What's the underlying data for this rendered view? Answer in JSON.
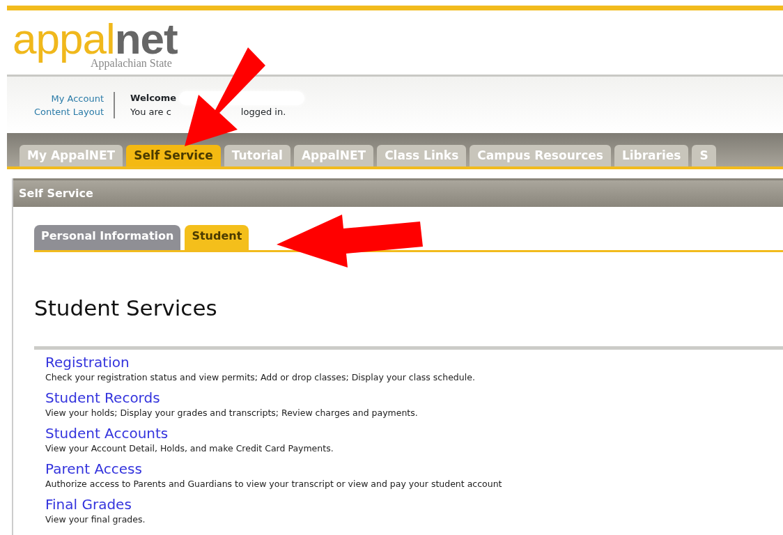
{
  "logo": {
    "part_1": "appal",
    "part_2": "net",
    "subtitle": "Appalachian State"
  },
  "account_links": [
    "My Account",
    "Content Layout"
  ],
  "welcome": {
    "title": "Welcome",
    "status_start": "You are c",
    "status_end": "logged in."
  },
  "main_tabs": [
    {
      "label": "My AppalNET",
      "selected": false
    },
    {
      "label": "Self Service",
      "selected": true
    },
    {
      "label": "Tutorial",
      "selected": false
    },
    {
      "label": "AppalNET",
      "selected": false
    },
    {
      "label": "Class Links",
      "selected": false
    },
    {
      "label": "Campus Resources",
      "selected": false
    },
    {
      "label": "Libraries",
      "selected": false
    },
    {
      "label": "S",
      "selected": false
    }
  ],
  "panel": {
    "title": "Self Service"
  },
  "sub_tabs": [
    {
      "label": "Personal Information",
      "selected": false
    },
    {
      "label": "Student",
      "selected": true
    }
  ],
  "heading": "Student Services",
  "services": [
    {
      "title": "Registration",
      "description": "Check your registration status and view permits; Add or drop classes; Display your class schedule."
    },
    {
      "title": "Student Records",
      "description": "View your holds; Display your grades and transcripts; Review charges and payments."
    },
    {
      "title": "Student Accounts",
      "description": "View your Account Detail, Holds, and make Credit Card Payments."
    },
    {
      "title": "Parent Access",
      "description": "Authorize access to Parents and Guardians to view your transcript or view and pay your student account"
    },
    {
      "title": "Final Grades",
      "description": "View your final grades."
    }
  ]
}
